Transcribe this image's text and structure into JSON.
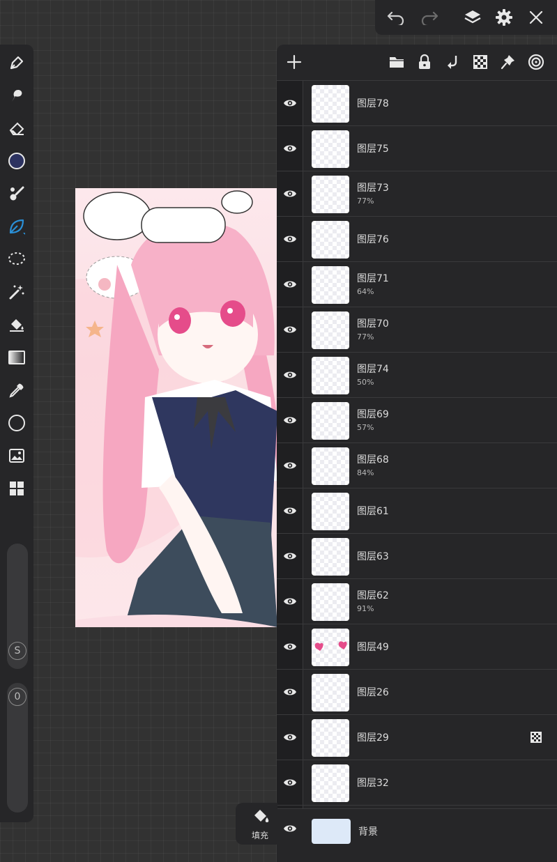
{
  "top_bar": {
    "icons": [
      "undo-icon",
      "redo-icon",
      "layers-icon",
      "gear-icon",
      "close-icon"
    ]
  },
  "left_toolbar": {
    "tools": [
      "pen-tool-icon",
      "smudge-icon",
      "eraser-icon",
      "color-swatch",
      "brush-icon",
      "lasso-leaf-icon",
      "selection-lasso-icon",
      "magic-wand-icon",
      "fill-bucket-icon",
      "gradient-icon",
      "eyedropper-icon",
      "shape-circle-icon",
      "image-transform-icon",
      "grid-icon"
    ],
    "current_color": "#2c3260",
    "size_label": "S",
    "opacity_label": "0"
  },
  "layers_panel": {
    "header_icons": [
      "add-icon",
      "folder-icon",
      "lock-icon",
      "merge-down-icon",
      "checker-icon",
      "pin-icon",
      "target-icon"
    ],
    "layers": [
      {
        "name": "图层78",
        "opacity": ""
      },
      {
        "name": "图层75",
        "opacity": ""
      },
      {
        "name": "图层73",
        "opacity": "77%"
      },
      {
        "name": "图层76",
        "opacity": ""
      },
      {
        "name": "图层71",
        "opacity": "64%"
      },
      {
        "name": "图层70",
        "opacity": "77%"
      },
      {
        "name": "图层74",
        "opacity": "50%"
      },
      {
        "name": "图层69",
        "opacity": "57%"
      },
      {
        "name": "图层68",
        "opacity": "84%"
      },
      {
        "name": "图层61",
        "opacity": ""
      },
      {
        "name": "图层63",
        "opacity": ""
      },
      {
        "name": "图层62",
        "opacity": "91%"
      },
      {
        "name": "图层49",
        "opacity": ""
      },
      {
        "name": "图层26",
        "opacity": ""
      },
      {
        "name": "图层29",
        "opacity": ""
      },
      {
        "name": "图层32",
        "opacity": ""
      }
    ],
    "background_layer": {
      "name": "背景",
      "color": "#dde9f8"
    }
  },
  "fill_button": {
    "label": "填充"
  },
  "colors": {
    "panel_bg": "#262628",
    "canvas_bg": "#323232",
    "accent_blue": "#2a8fd6"
  }
}
